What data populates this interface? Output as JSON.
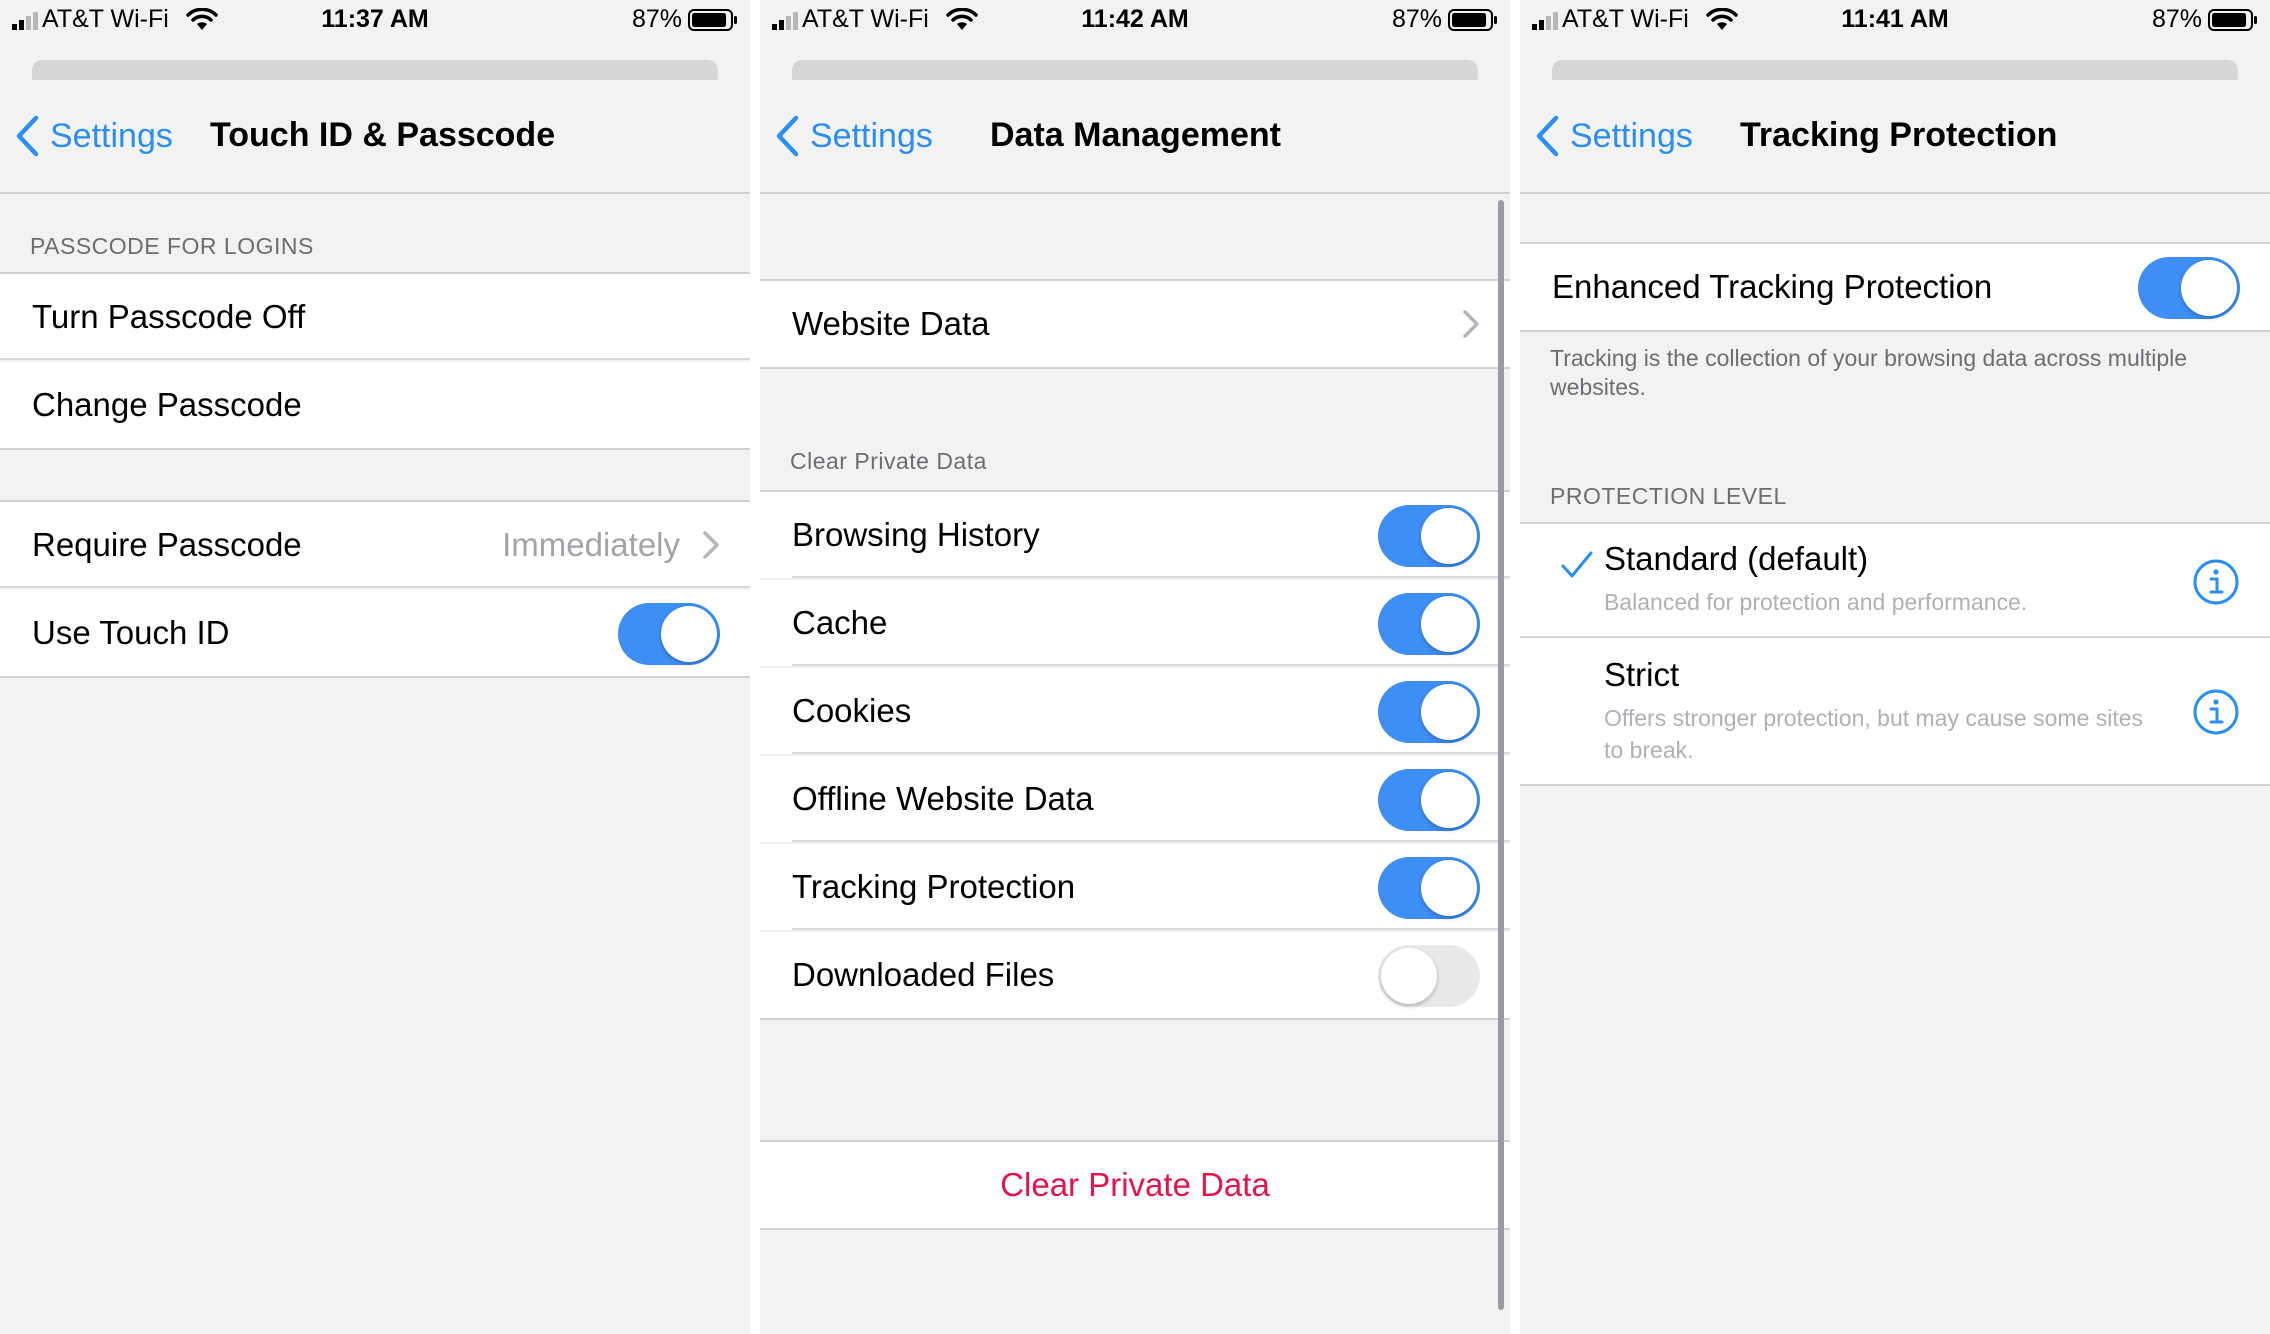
{
  "colors": {
    "accent": "#2c8ef0",
    "toggle_on": "#3d8ff5",
    "toggle_off": "#e9e9ea",
    "destructive": "#e0144f",
    "background": "#f2f2f3"
  },
  "screens": [
    {
      "status": {
        "carrier": "AT&T Wi-Fi",
        "time": "11:37 AM",
        "battery": "87%"
      },
      "nav": {
        "back_label": "Settings",
        "title": "Touch ID & Passcode"
      },
      "section_header": "PASSCODE FOR LOGINS",
      "items": [
        {
          "label": "Turn Passcode Off"
        },
        {
          "label": "Change Passcode"
        }
      ],
      "items2": [
        {
          "label": "Require Passcode",
          "value": "Immediately"
        },
        {
          "label": "Use Touch ID",
          "toggle": true
        }
      ]
    },
    {
      "status": {
        "carrier": "AT&T Wi-Fi",
        "time": "11:42 AM",
        "battery": "87%"
      },
      "nav": {
        "back_label": "Settings",
        "title": "Data Management"
      },
      "website_data": {
        "label": "Website Data"
      },
      "section_header": "Clear Private Data",
      "toggles": [
        {
          "label": "Browsing History",
          "on": true
        },
        {
          "label": "Cache",
          "on": true
        },
        {
          "label": "Cookies",
          "on": true
        },
        {
          "label": "Offline Website Data",
          "on": true
        },
        {
          "label": "Tracking Protection",
          "on": true
        },
        {
          "label": "Downloaded Files",
          "on": false
        }
      ],
      "clear_button": "Clear Private Data"
    },
    {
      "status": {
        "carrier": "AT&T Wi-Fi",
        "time": "11:41 AM",
        "battery": "87%"
      },
      "nav": {
        "back_label": "Settings",
        "title": "Tracking Protection"
      },
      "etp": {
        "label": "Enhanced Tracking Protection",
        "on": true
      },
      "etp_footer": "Tracking is the collection of your browsing data across multiple websites.",
      "section_header": "PROTECTION LEVEL",
      "levels": [
        {
          "title": "Standard (default)",
          "subtitle": "Balanced for protection and performance.",
          "selected": true
        },
        {
          "title": "Strict",
          "subtitle": "Offers stronger protection, but may cause some sites to break.",
          "selected": false
        }
      ]
    }
  ]
}
